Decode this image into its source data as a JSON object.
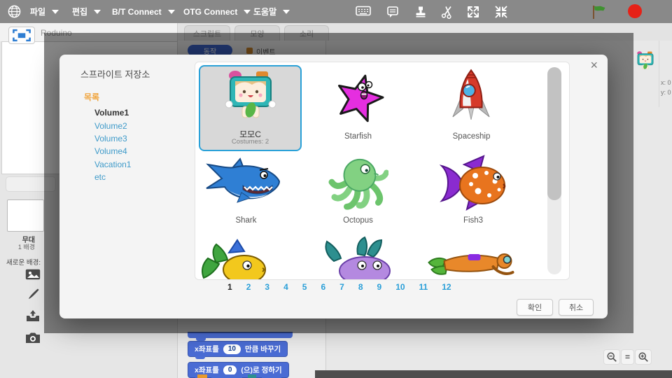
{
  "colors": {
    "menu_bar_bg": "#898989",
    "flag_green": "#3f9130",
    "stop_red": "#e62117",
    "motion_block_blue": "#4a6cd4",
    "selected_border_blue": "#2aa1d8",
    "link_blue": "#3e9ac9",
    "header_orange": "#f0a43c"
  },
  "menu_bar": {
    "items": [
      {
        "label": "파일"
      },
      {
        "label": "편집"
      },
      {
        "label": "B/T Connect"
      },
      {
        "label": "OTG Connect"
      },
      {
        "label": "도움말"
      }
    ]
  },
  "editor": {
    "project_title": "Roduino",
    "tabs": [
      {
        "label": "스크립트"
      },
      {
        "label": "모양"
      },
      {
        "label": "소리"
      }
    ],
    "palette_categories": [
      {
        "label": "동작"
      },
      {
        "label": "이벤트"
      }
    ],
    "stage_panel": {
      "stage_label": "무대",
      "backdrop_count": "1 배경",
      "new_backdrop_label": "새로운 배경:"
    },
    "palette_blocks": [
      {
        "pre": "x좌표를",
        "value": "10",
        "post": "만큼  바꾸기"
      },
      {
        "pre": "x좌표를",
        "value": "0",
        "post": "(으)로  정하기"
      }
    ],
    "sprite_info": {
      "x": "x: 0",
      "y": "y: 0"
    },
    "zoom_controls": {
      "equals": "="
    }
  },
  "modal": {
    "title": "스프라이트 저장소",
    "close_label": "×",
    "sidebar": {
      "header": "목록",
      "items": [
        {
          "label": "Volume1",
          "selected": true
        },
        {
          "label": "Volume2"
        },
        {
          "label": "Volume3"
        },
        {
          "label": "Volume4"
        },
        {
          "label": "Vacation1"
        },
        {
          "label": "etc"
        }
      ]
    },
    "sprites": [
      {
        "label": "모모C",
        "sublabel": "Costumes: 2",
        "selected": true
      },
      {
        "label": "Starfish"
      },
      {
        "label": "Spaceship"
      },
      {
        "label": "Shark"
      },
      {
        "label": "Octopus"
      },
      {
        "label": "Fish3"
      }
    ],
    "pagination": {
      "current": "1",
      "pages": [
        "1",
        "2",
        "3",
        "4",
        "5",
        "6",
        "7",
        "8",
        "9",
        "10",
        "11",
        "12"
      ]
    },
    "buttons": {
      "ok": "확인",
      "cancel": "취소"
    }
  }
}
